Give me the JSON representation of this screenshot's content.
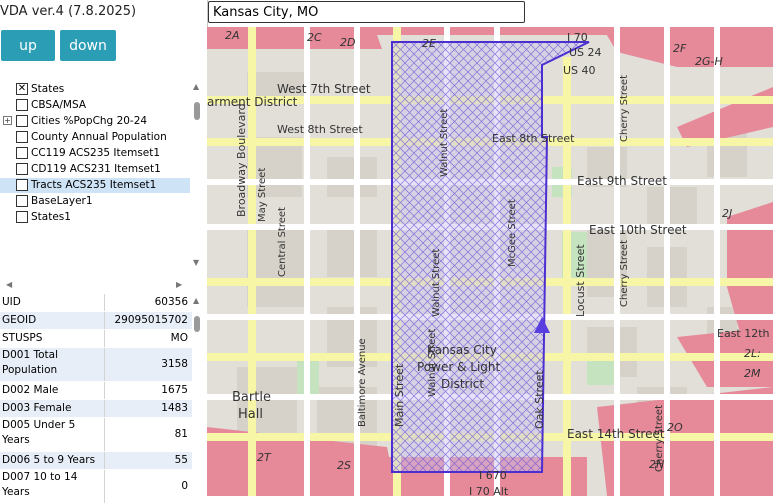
{
  "app": {
    "title": "VDA ver.4 (7.8.2025)"
  },
  "toolbar": {
    "up_label": "up",
    "down_label": "down"
  },
  "search": {
    "value": "Kansas City, MO"
  },
  "layers": [
    {
      "label": "States",
      "checked": true
    },
    {
      "label": "CBSA/MSA",
      "checked": false
    },
    {
      "label": "Cities %PopChg 20-24",
      "checked": false,
      "expandable": true
    },
    {
      "label": "County Annual Population",
      "checked": false
    },
    {
      "label": "CC119 ACS235 Itemset1",
      "checked": false
    },
    {
      "label": "CD119 ACS231 Itemset1",
      "checked": false
    },
    {
      "label": "Tracts ACS235 Itemset1",
      "checked": false,
      "selected": true
    },
    {
      "label": "BaseLayer1",
      "checked": false
    },
    {
      "label": "States1",
      "checked": false
    }
  ],
  "attributes": [
    {
      "key": "UID",
      "value": "60356"
    },
    {
      "key": "GEOID",
      "value": "29095015702"
    },
    {
      "key": "STUSPS",
      "value": "MO"
    },
    {
      "key": "D001 Total Population",
      "value": "3158"
    },
    {
      "key": "D002 Male",
      "value": "1675"
    },
    {
      "key": "D003 Female",
      "value": "1483"
    },
    {
      "key": "D005 Under 5 Years",
      "value": "81"
    },
    {
      "key": "D006 5 to 9 Years",
      "value": "55"
    },
    {
      "key": "D007 10 to 14 Years",
      "value": "0"
    }
  ],
  "map": {
    "labels": {
      "west7": "West 7th Street",
      "west8": "West 8th Street",
      "east8": "East 8th Street",
      "east9": "East 9th Street",
      "east10": "East 10th Street",
      "east12": "East 12th",
      "east14": "East 14th Street",
      "garment": "arment District",
      "broadway": "Broadway Boulevard",
      "may": "May Street",
      "central": "Central Street",
      "baltimore": "Baltimore Avenue",
      "main": "Main Street",
      "walnut1": "Walnut Street",
      "walnut2": "Walnut Street",
      "walnut3": "Walnut Street",
      "mcgee": "McGee Street",
      "oak": "Oak Street",
      "locust": "Locust Street",
      "cherry1": "Cherry Street",
      "cherry2": "Cherry Street",
      "cherry3": "Cherry Street",
      "bartle1": "Bartle",
      "bartle2": "Hall",
      "kc1": "Kansas City",
      "kc2": "Power & Light",
      "kc3": "District",
      "i70": "I 70",
      "us24": "US 24",
      "us40": "US 40",
      "i670": "I 670",
      "i70alt": "I 70 Alt",
      "r2a": "2A",
      "r2c": "2C",
      "r2d": "2D",
      "r2e": "2E",
      "r2f": "2F",
      "r2gh": "2G-H",
      "r2j": "2J",
      "r2l": "2L:",
      "r2m": "2M",
      "r2o": "2O",
      "r2n": "2N",
      "r2t": "2T",
      "r2s": "2S"
    },
    "colors": {
      "tract": "#4b2fd0",
      "highway": "#e68a9a",
      "primary": "#f8f8a8"
    }
  }
}
